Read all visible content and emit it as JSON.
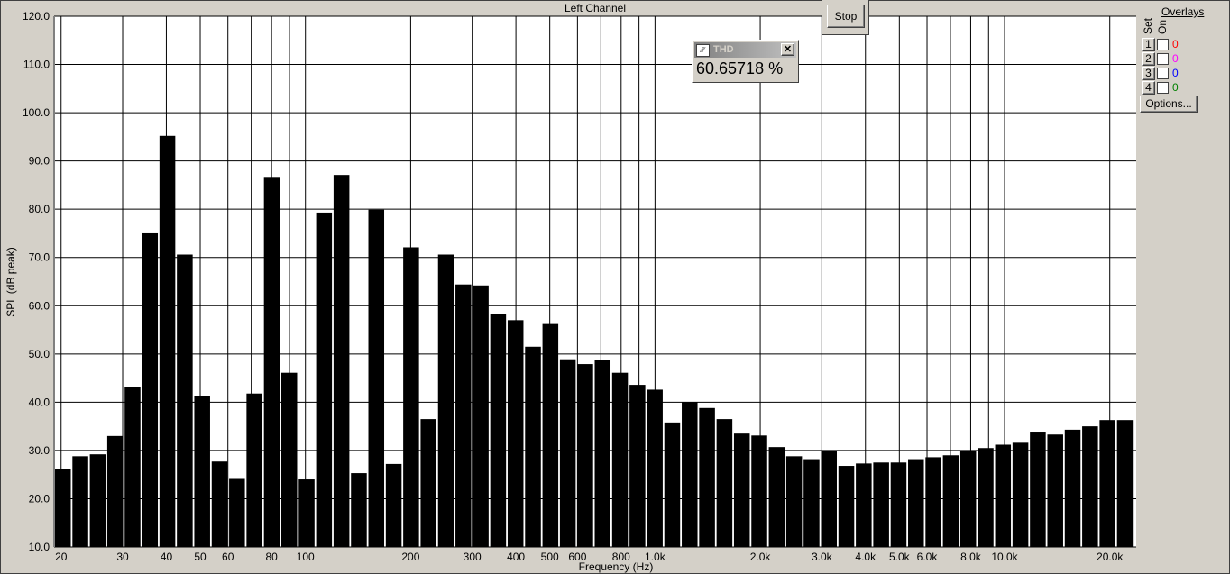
{
  "window": {
    "title": "Left Channel"
  },
  "controls": {
    "stop_label": "Stop"
  },
  "thd_meter": {
    "label": "THD",
    "value": "60.65718 %",
    "close_label": "✕",
    "icon": "waveform-icon"
  },
  "overlays": {
    "title": "Overlays",
    "set_label": "Set",
    "on_label": "On",
    "rows": [
      {
        "num": "1",
        "value": "0",
        "color": "#ff0000"
      },
      {
        "num": "2",
        "value": "0",
        "color": "#ff00ff"
      },
      {
        "num": "3",
        "value": "0",
        "color": "#0000ff"
      },
      {
        "num": "4",
        "value": "0",
        "color": "#008000"
      }
    ],
    "options_label": "Options..."
  },
  "chart_data": {
    "type": "bar",
    "title": "Left Channel",
    "xlabel": "Frequency (Hz)",
    "ylabel": "SPL (dB peak)",
    "ylim": [
      10,
      120
    ],
    "xscale": "log",
    "xlim": [
      19.1,
      23800
    ],
    "grid": true,
    "yticks": [
      "10.0",
      "20.0",
      "30.0",
      "40.0",
      "50.0",
      "60.0",
      "70.0",
      "80.0",
      "90.0",
      "100.0",
      "110.0",
      "120.0"
    ],
    "ytick_values": [
      10,
      20,
      30,
      40,
      50,
      60,
      70,
      80,
      90,
      100,
      110,
      120
    ],
    "xticks": [
      {
        "label": "20",
        "f": 20
      },
      {
        "label": "30",
        "f": 30
      },
      {
        "label": "40",
        "f": 40
      },
      {
        "label": "50",
        "f": 50
      },
      {
        "label": "60",
        "f": 60
      },
      {
        "label": "80",
        "f": 80
      },
      {
        "label": "100",
        "f": 100
      },
      {
        "label": "200",
        "f": 200
      },
      {
        "label": "300",
        "f": 300
      },
      {
        "label": "400",
        "f": 400
      },
      {
        "label": "500",
        "f": 500
      },
      {
        "label": "600",
        "f": 600
      },
      {
        "label": "800",
        "f": 800
      },
      {
        "label": "1.0k",
        "f": 1000
      },
      {
        "label": "2.0k",
        "f": 2000
      },
      {
        "label": "3.0k",
        "f": 3000
      },
      {
        "label": "4.0k",
        "f": 4000
      },
      {
        "label": "5.0k",
        "f": 5000
      },
      {
        "label": "6.0k",
        "f": 6000
      },
      {
        "label": "8.0k",
        "f": 8000
      },
      {
        "label": "10.0k",
        "f": 10000
      },
      {
        "label": "20.0k",
        "f": 20000
      }
    ],
    "gridlines_f": [
      20,
      30,
      40,
      50,
      60,
      70,
      80,
      90,
      100,
      200,
      300,
      400,
      500,
      600,
      700,
      800,
      900,
      1000,
      2000,
      3000,
      4000,
      5000,
      6000,
      7000,
      8000,
      9000,
      10000,
      20000
    ],
    "values": [
      26.2,
      28.8,
      29.2,
      33.0,
      43.1,
      75.0,
      95.2,
      70.6,
      41.2,
      27.7,
      24.1,
      41.8,
      86.7,
      46.1,
      24.0,
      79.3,
      87.1,
      25.3,
      79.9,
      27.2,
      72.1,
      36.5,
      70.6,
      64.4,
      64.2,
      58.2,
      57.0,
      51.5,
      56.2,
      48.9,
      47.9,
      48.8,
      46.1,
      43.6,
      42.6,
      35.8,
      40.0,
      38.8,
      36.5,
      33.5,
      33.1,
      30.7,
      28.8,
      28.2,
      29.9,
      26.8,
      27.3,
      27.5,
      27.5,
      28.2,
      28.6,
      29.0,
      29.9,
      30.5,
      31.2,
      31.6,
      33.9,
      33.3,
      34.3,
      35.0,
      36.3,
      36.3
    ]
  }
}
